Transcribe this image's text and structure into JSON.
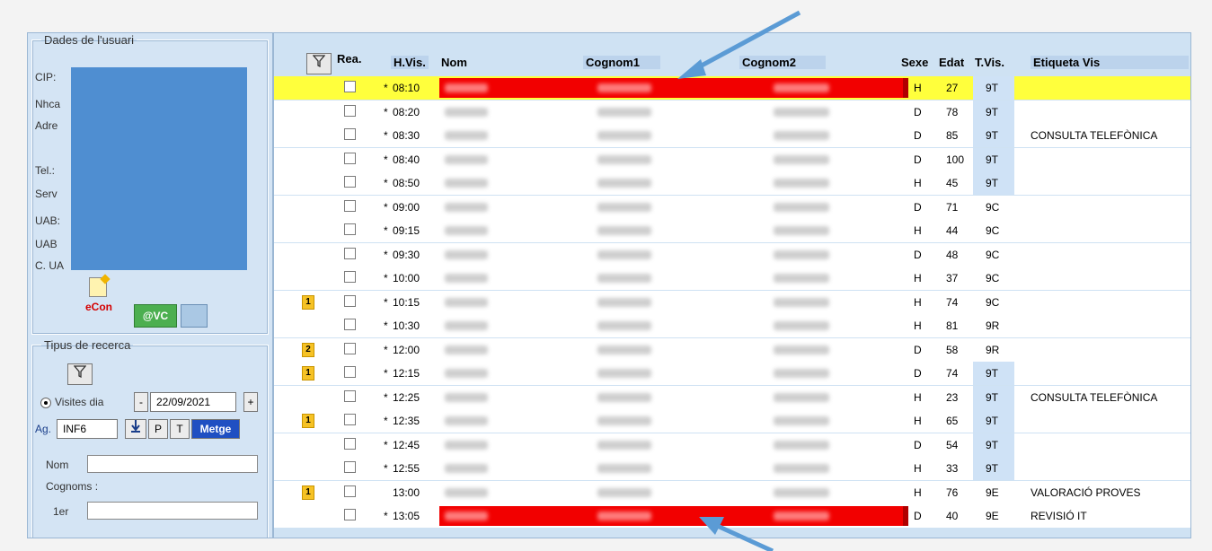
{
  "user_panel": {
    "legend": "Dades de l'usuari",
    "labels": [
      "CIP:",
      "Nhca",
      "Adre",
      "Tel.:",
      "Serv",
      "UAB:",
      "UAB",
      "C. UA"
    ],
    "econ_label": "eCon",
    "vc_label": "@VC"
  },
  "search_panel": {
    "legend": "Tipus de recerca",
    "radio_label": "Visites dia",
    "date_value": "22/09/2021",
    "minus_label": "-",
    "plus_label": "+",
    "ag_label": "Ag.",
    "ag_value": "INF6",
    "p_label": "P",
    "t_label": "T",
    "metge_label": "Metge",
    "nom_label": "Nom",
    "cognoms_label": "Cognoms :",
    "primer_label": "1er"
  },
  "grid": {
    "headers": {
      "rea": "Rea.",
      "hvis": "H.Vis.",
      "nom": "Nom",
      "cognom1": "Cognom1",
      "cognom2": "Cognom2",
      "sexe": "Sexe",
      "edat": "Edat",
      "tvis": "T.Vis.",
      "etiqueta": "Etiqueta Vis"
    },
    "rows": [
      {
        "flag": "",
        "star": "*",
        "time": "08:10",
        "sex": "H",
        "age": "27",
        "tvis": "9T",
        "label": "",
        "highlight": true,
        "red": true,
        "tvis_bg": true
      },
      {
        "flag": "",
        "star": "*",
        "time": "08:20",
        "sex": "D",
        "age": "78",
        "tvis": "9T",
        "label": "",
        "tvis_bg": true
      },
      {
        "flag": "",
        "star": "*",
        "time": "08:30",
        "sex": "D",
        "age": "85",
        "tvis": "9T",
        "label": "CONSULTA TELEFÒNICA",
        "tvis_bg": true
      },
      {
        "flag": "",
        "star": "*",
        "time": "08:40",
        "sex": "D",
        "age": "100",
        "tvis": "9T",
        "label": "",
        "tvis_bg": true
      },
      {
        "flag": "",
        "star": "*",
        "time": "08:50",
        "sex": "H",
        "age": "45",
        "tvis": "9T",
        "label": "",
        "tvis_bg": true
      },
      {
        "flag": "",
        "star": "*",
        "time": "09:00",
        "sex": "D",
        "age": "71",
        "tvis": "9C",
        "label": ""
      },
      {
        "flag": "",
        "star": "*",
        "time": "09:15",
        "sex": "H",
        "age": "44",
        "tvis": "9C",
        "label": ""
      },
      {
        "flag": "",
        "star": "*",
        "time": "09:30",
        "sex": "D",
        "age": "48",
        "tvis": "9C",
        "label": ""
      },
      {
        "flag": "",
        "star": "*",
        "time": "10:00",
        "sex": "H",
        "age": "37",
        "tvis": "9C",
        "label": ""
      },
      {
        "flag": "1",
        "star": "*",
        "time": "10:15",
        "sex": "H",
        "age": "74",
        "tvis": "9C",
        "label": ""
      },
      {
        "flag": "",
        "star": "*",
        "time": "10:30",
        "sex": "H",
        "age": "81",
        "tvis": "9R",
        "label": ""
      },
      {
        "flag": "2",
        "star": "*",
        "time": "12:00",
        "sex": "D",
        "age": "58",
        "tvis": "9R",
        "label": ""
      },
      {
        "flag": "1",
        "star": "*",
        "time": "12:15",
        "sex": "D",
        "age": "74",
        "tvis": "9T",
        "label": "",
        "tvis_bg": true
      },
      {
        "flag": "",
        "star": "*",
        "time": "12:25",
        "sex": "H",
        "age": "23",
        "tvis": "9T",
        "label": "CONSULTA TELEFÒNICA",
        "tvis_bg": true
      },
      {
        "flag": "1",
        "star": "*",
        "time": "12:35",
        "sex": "H",
        "age": "65",
        "tvis": "9T",
        "label": "",
        "tvis_bg": true
      },
      {
        "flag": "",
        "star": "*",
        "time": "12:45",
        "sex": "D",
        "age": "54",
        "tvis": "9T",
        "label": "",
        "tvis_bg": true
      },
      {
        "flag": "",
        "star": "*",
        "time": "12:55",
        "sex": "H",
        "age": "33",
        "tvis": "9T",
        "label": "",
        "tvis_bg": true
      },
      {
        "flag": "1",
        "star": "",
        "time": "13:00",
        "sex": "H",
        "age": "76",
        "tvis": "9E",
        "label": "VALORACIÓ PROVES"
      },
      {
        "flag": "",
        "star": "*",
        "time": "13:05",
        "sex": "D",
        "age": "40",
        "tvis": "9E",
        "label": "REVISIÓ IT",
        "red": true
      }
    ]
  },
  "colors": {
    "highlight_row": "#ffff3c",
    "red_bar": "#f20000",
    "tvis_highlight": "#cfe2f6",
    "arrow": "#5b9bd5"
  }
}
